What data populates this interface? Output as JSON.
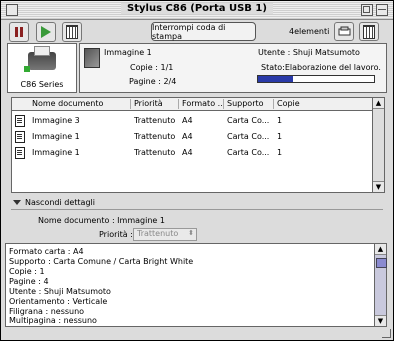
{
  "window": {
    "title": "Stylus C86 (Porta USB 1)"
  },
  "toolbar": {
    "stop_queue_label": "Interrompi coda di stampa",
    "count_label": "4elementi"
  },
  "printer": {
    "name": "C86 Series"
  },
  "job": {
    "name": "Immagine 1",
    "copies": "Copie : 1/1",
    "pages": "Pagine : 2/4",
    "user": "Utente : Shuji Matsumoto",
    "status": "Stato:Elaborazione del lavoro.",
    "progress_fraction": 0.3
  },
  "queue": {
    "columns": [
      "Nome documento",
      "Priorità",
      "Formato ...",
      "Supporto",
      "Copie"
    ],
    "rows": [
      {
        "name": "Immagine 3",
        "priority": "Trattenuto",
        "format": "A4",
        "media": "Carta Co...",
        "copies": "1"
      },
      {
        "name": "Immagine 1",
        "priority": "Trattenuto",
        "format": "A4",
        "media": "Carta Co...",
        "copies": "1"
      },
      {
        "name": "Immagine 1",
        "priority": "Trattenuto",
        "format": "A4",
        "media": "Carta Co...",
        "copies": "1"
      }
    ]
  },
  "details": {
    "toggle_label": "Nascondi dettagli",
    "doc_name": "Nome documento : Immagine 1",
    "priority_label": "Priorità :",
    "priority_value": "Trattenuto",
    "lines": [
      "Formato carta : A4",
      "Supporto : Carta Comune / Carta Bright White",
      "Copie : 1",
      "Pagine : 4",
      "Utente : Shuji Matsumoto",
      "Orientamento : Verticale",
      "Filigrana : nessuno",
      "Multipagina : nessuno"
    ]
  }
}
